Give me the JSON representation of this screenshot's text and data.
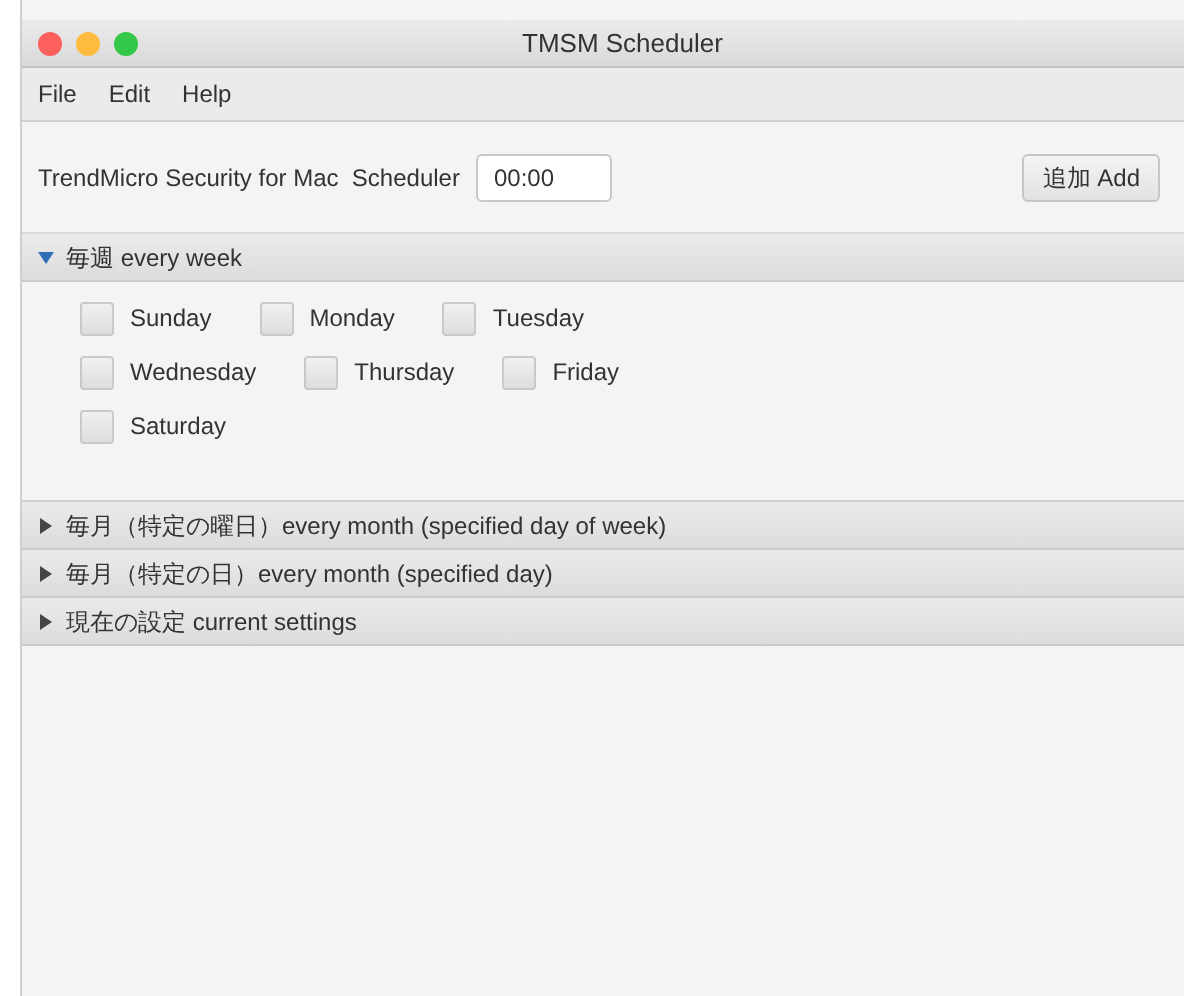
{
  "window": {
    "title": "TMSM Scheduler"
  },
  "menu": [
    "File",
    "Edit",
    "Help"
  ],
  "toolbar": {
    "label": "TrendMicro Security for Mac  Scheduler",
    "time": "00:00",
    "add_button": "追加 Add"
  },
  "sections": [
    {
      "title": "毎週 every week",
      "expanded": true,
      "day_rows": [
        [
          {
            "label": "Sunday",
            "checked": false
          },
          {
            "label": "Monday",
            "checked": false
          },
          {
            "label": "Tuesday",
            "checked": false
          }
        ],
        [
          {
            "label": "Wednesday",
            "checked": false
          },
          {
            "label": "Thursday",
            "checked": false
          },
          {
            "label": "Friday",
            "checked": false
          }
        ],
        [
          {
            "label": "Saturday",
            "checked": false
          }
        ]
      ]
    },
    {
      "title": "毎月（特定の曜日）every month (specified day of week)",
      "expanded": false
    },
    {
      "title": "毎月（特定の日）every month (specified day)",
      "expanded": false
    },
    {
      "title": "現在の設定 current settings",
      "expanded": false
    }
  ]
}
